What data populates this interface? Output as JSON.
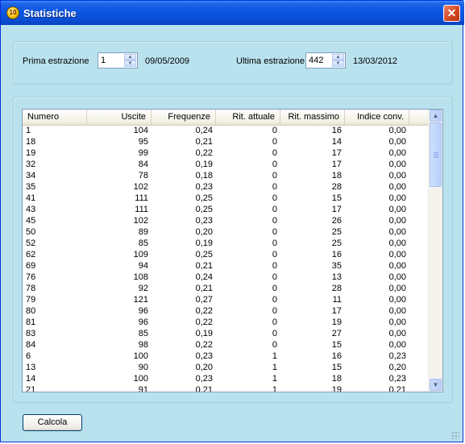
{
  "window": {
    "title": "Statistiche",
    "app_icon": "lottery-ball-icon",
    "close_glyph": "✕"
  },
  "range": {
    "first_label": "Prima estrazione",
    "first_value": "1",
    "first_date": "09/05/2009",
    "last_label": "Ultima estrazione",
    "last_value": "442",
    "last_date": "13/03/2012"
  },
  "table": {
    "columns": [
      "Numero",
      "Uscite",
      "Frequenze",
      "Rit. attuale",
      "Rit. massimo",
      "Indice conv."
    ],
    "rows": [
      [
        "1",
        "104",
        "0,24",
        "0",
        "16",
        "0,00"
      ],
      [
        "18",
        "95",
        "0,21",
        "0",
        "14",
        "0,00"
      ],
      [
        "19",
        "99",
        "0,22",
        "0",
        "17",
        "0,00"
      ],
      [
        "32",
        "84",
        "0,19",
        "0",
        "17",
        "0,00"
      ],
      [
        "34",
        "78",
        "0,18",
        "0",
        "18",
        "0,00"
      ],
      [
        "35",
        "102",
        "0,23",
        "0",
        "28",
        "0,00"
      ],
      [
        "41",
        "111",
        "0,25",
        "0",
        "15",
        "0,00"
      ],
      [
        "43",
        "111",
        "0,25",
        "0",
        "17",
        "0,00"
      ],
      [
        "45",
        "102",
        "0,23",
        "0",
        "26",
        "0,00"
      ],
      [
        "50",
        "89",
        "0,20",
        "0",
        "25",
        "0,00"
      ],
      [
        "52",
        "85",
        "0,19",
        "0",
        "25",
        "0,00"
      ],
      [
        "62",
        "109",
        "0,25",
        "0",
        "16",
        "0,00"
      ],
      [
        "69",
        "94",
        "0,21",
        "0",
        "35",
        "0,00"
      ],
      [
        "76",
        "108",
        "0,24",
        "0",
        "13",
        "0,00"
      ],
      [
        "78",
        "92",
        "0,21",
        "0",
        "28",
        "0,00"
      ],
      [
        "79",
        "121",
        "0,27",
        "0",
        "11",
        "0,00"
      ],
      [
        "80",
        "96",
        "0,22",
        "0",
        "17",
        "0,00"
      ],
      [
        "81",
        "96",
        "0,22",
        "0",
        "19",
        "0,00"
      ],
      [
        "83",
        "85",
        "0,19",
        "0",
        "27",
        "0,00"
      ],
      [
        "84",
        "98",
        "0,22",
        "0",
        "15",
        "0,00"
      ],
      [
        "6",
        "100",
        "0,23",
        "1",
        "16",
        "0,23"
      ],
      [
        "13",
        "90",
        "0,20",
        "1",
        "15",
        "0,20"
      ],
      [
        "14",
        "100",
        "0,23",
        "1",
        "18",
        "0,23"
      ],
      [
        "21",
        "91",
        "0,21",
        "1",
        "19",
        "0,21"
      ]
    ]
  },
  "actions": {
    "calc_label": "Calcola"
  },
  "colors": {
    "title_bar": "#0a54e2",
    "dialog_bg": "#b9e2ee",
    "list_bg": "#ffffff"
  }
}
